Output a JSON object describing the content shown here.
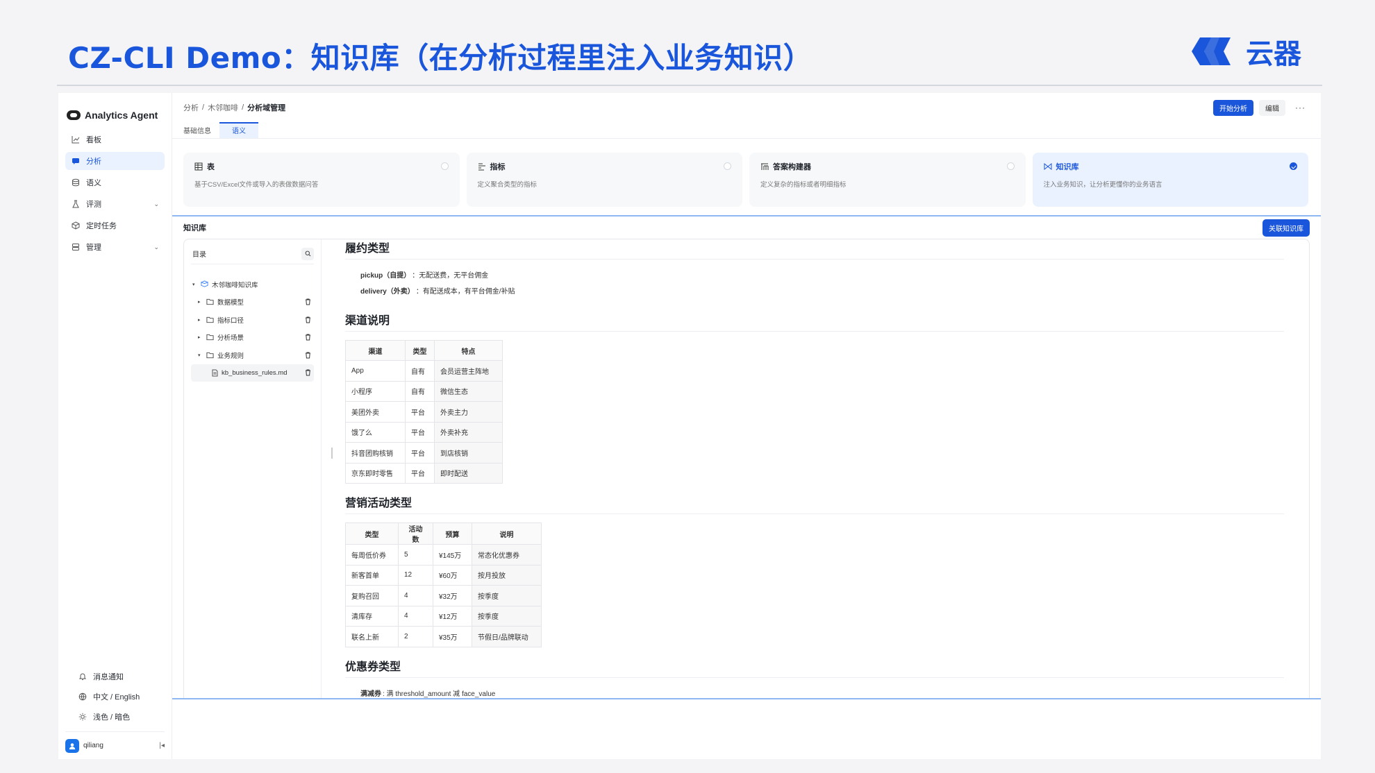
{
  "slide": {
    "title": "CZ-CLI Demo：知识库（在分析过程里注入业务知识）",
    "logo_text": "云器",
    "brand_color": "#1a56db"
  },
  "sidebar": {
    "brand": "Analytics Agent",
    "items": [
      {
        "label": "看板",
        "icon": "chart-icon"
      },
      {
        "label": "分析",
        "icon": "chat-icon",
        "active": true
      },
      {
        "label": "语义",
        "icon": "database-icon"
      },
      {
        "label": "评测",
        "icon": "flask-icon",
        "expandable": true
      },
      {
        "label": "定时任务",
        "icon": "box-icon"
      },
      {
        "label": "管理",
        "icon": "server-icon",
        "expandable": true
      }
    ],
    "bottom": [
      {
        "label": "消息通知",
        "icon": "bell-icon"
      },
      {
        "label": "中文 / English",
        "icon": "globe-icon"
      },
      {
        "label": "浅色 / 暗色",
        "icon": "sun-icon"
      }
    ],
    "user": "qiliang"
  },
  "topbar": {
    "breadcrumbs": [
      "分析",
      "木邻咖啡",
      "分析域管理"
    ],
    "start_label": "开始分析",
    "edit_label": "编辑",
    "more_label": "···"
  },
  "tabs": [
    {
      "label": "基础信息",
      "active": false
    },
    {
      "label": "语义",
      "active": true
    }
  ],
  "cards": [
    {
      "title": "表",
      "desc": "基于CSV/Excel文件或导入的表做数据问答",
      "active": false
    },
    {
      "title": "指标",
      "desc": "定义聚合类型的指标",
      "active": false
    },
    {
      "title": "答案构建器",
      "desc": "定义复杂的指标或者明细指标",
      "active": false
    },
    {
      "title": "知识库",
      "desc": "注入业务知识，让分析更懂你的业务语言",
      "active": true
    }
  ],
  "kb": {
    "title": "知识库",
    "link_button": "关联知识库",
    "toc_label": "目录",
    "tree": {
      "root": "木邻咖啡知识库",
      "folders": [
        "数据模型",
        "指标口径",
        "分析场景",
        "业务规则"
      ],
      "file": "kb_business_rules.md"
    }
  },
  "doc": {
    "fulfillment": {
      "heading": "履约类型",
      "items": [
        {
          "key": "pickup（自提）",
          "text": "：无配送费，无平台佣金"
        },
        {
          "key": "delivery（外卖）",
          "text": "：有配送成本，有平台佣金/补贴"
        }
      ]
    },
    "channels": {
      "heading": "渠道说明",
      "columns": [
        "渠道",
        "类型",
        "特点"
      ],
      "rows": [
        [
          "App",
          "自有",
          "会员运营主阵地"
        ],
        [
          "小程序",
          "自有",
          "微信生态"
        ],
        [
          "美团外卖",
          "平台",
          "外卖主力"
        ],
        [
          "饿了么",
          "平台",
          "外卖补充"
        ],
        [
          "抖音团购核销",
          "平台",
          "到店核销"
        ],
        [
          "京东即时零售",
          "平台",
          "即时配送"
        ]
      ]
    },
    "campaigns": {
      "heading": "营销活动类型",
      "columns": [
        "类型",
        "活动数",
        "预算",
        "说明"
      ],
      "rows": [
        [
          "每周低价券",
          "5",
          "¥145万",
          "常态化优惠券"
        ],
        [
          "新客首单",
          "12",
          "¥60万",
          "按月投放"
        ],
        [
          "复购召回",
          "4",
          "¥32万",
          "按季度"
        ],
        [
          "清库存",
          "4",
          "¥12万",
          "按季度"
        ],
        [
          "联名上新",
          "2",
          "¥35万",
          "节假日/品牌联动"
        ]
      ]
    },
    "coupons": {
      "heading": "优惠券类型",
      "first_key": "满减券",
      "first_text": ": 满 threshold_amount 减 face_value"
    }
  }
}
